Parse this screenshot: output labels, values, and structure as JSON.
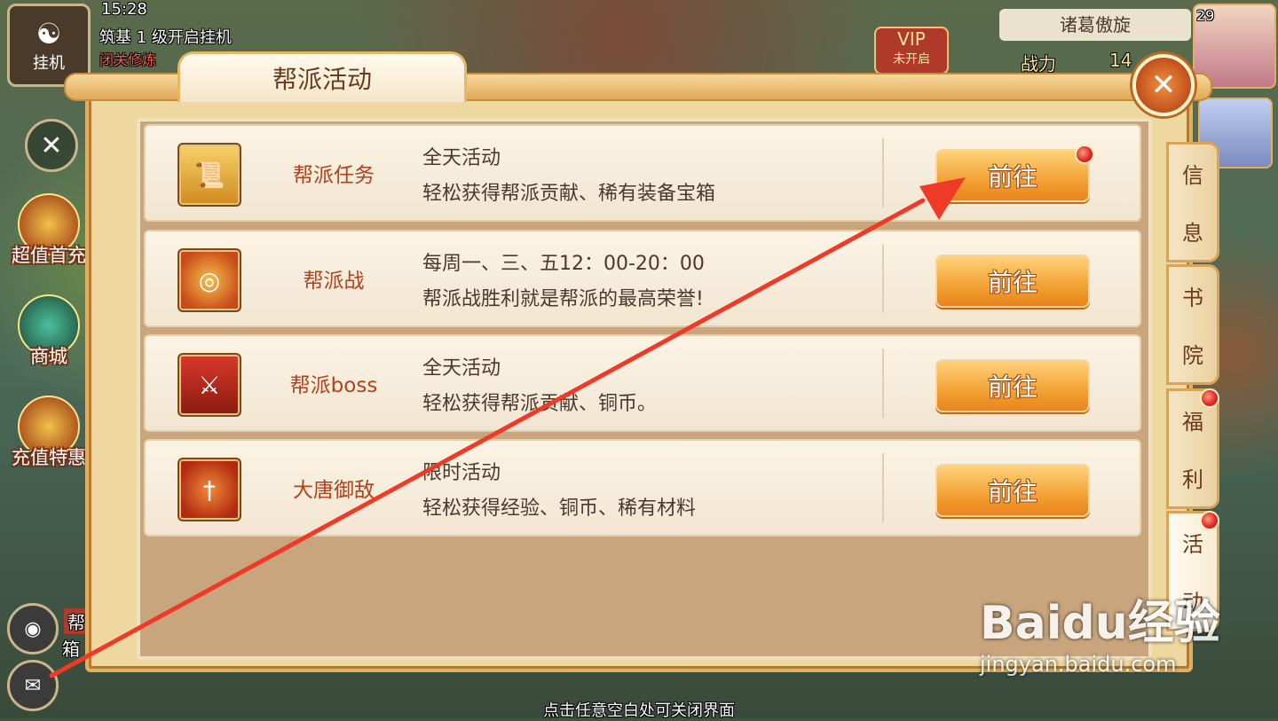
{
  "hud": {
    "time": "15:28",
    "status_line": "筑基 1 级开启挂机",
    "status_sub": "闭关修炼",
    "hangup_label": "挂机",
    "vip_label": "VIP",
    "vip_sub": "未开启",
    "player_name": "诸葛傲旋",
    "power_label": "战力",
    "power_value": "14",
    "level": "29"
  },
  "side_menu": [
    {
      "label": "超值首充"
    },
    {
      "label": "商城"
    },
    {
      "label": "充值特惠"
    }
  ],
  "bottom_chat": {
    "channel": "帮派",
    "text": "箱"
  },
  "panel": {
    "title": "帮派活动",
    "activities": [
      {
        "name": "帮派任务",
        "line1": "全天活动",
        "line2": "轻松获得帮派贡献、稀有装备宝箱",
        "button": "前往",
        "icon": "scroll-icon",
        "badge": true
      },
      {
        "name": "帮派战",
        "line1": "每周一、三、五12：00-20：00",
        "line2": "帮派战胜利就是帮派的最高荣誉!",
        "button": "前往",
        "icon": "drum-icon",
        "badge": false
      },
      {
        "name": "帮派boss",
        "line1": "全天活动",
        "line2": "轻松获得帮派贡献、铜币。",
        "button": "前往",
        "icon": "crossed-swords-icon",
        "badge": false
      },
      {
        "name": "大唐御敌",
        "line1": "限时活动",
        "line2": "轻松获得经验、铜币、稀有材料",
        "button": "前往",
        "icon": "sword-emblem-icon",
        "badge": false
      }
    ],
    "tabs": [
      {
        "chars": [
          "信",
          "息"
        ],
        "badge": false
      },
      {
        "chars": [
          "书",
          "院"
        ],
        "badge": false
      },
      {
        "chars": [
          "福",
          "利"
        ],
        "badge": true
      },
      {
        "chars": [
          "活",
          "动"
        ],
        "badge": true
      }
    ]
  },
  "hint": "点击任意空白处可关闭界面",
  "watermark": {
    "brand": "Baidu经验",
    "url": "jingyan.baidu.com"
  },
  "colors": {
    "accent": "#f09a2a",
    "title_text": "#6b3a1e",
    "activity_name": "#b4401c",
    "arrow": "#f03a28"
  }
}
